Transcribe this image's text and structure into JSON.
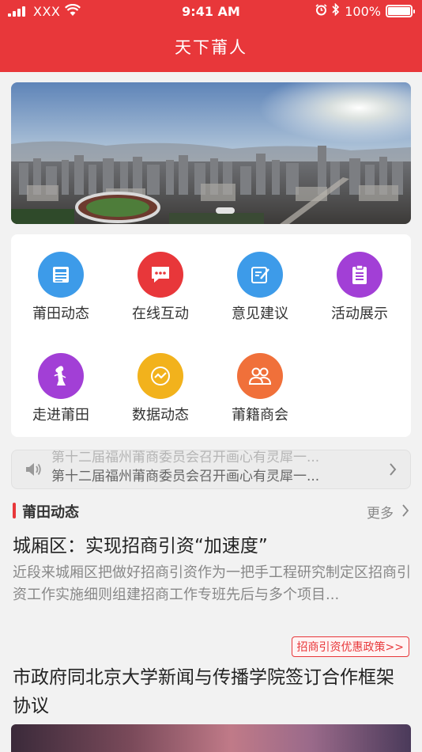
{
  "status_bar": {
    "carrier": "XXX",
    "time": "9:41 AM",
    "battery": "100%"
  },
  "nav": {
    "title": "天下莆人"
  },
  "banner": {
    "image": "city-skyline-photo"
  },
  "menu": [
    {
      "label": "莆田动态",
      "icon": "news-icon",
      "color": "#3d9be9"
    },
    {
      "label": "在线互动",
      "icon": "chat-icon",
      "color": "#e8373a"
    },
    {
      "label": "意见建议",
      "icon": "feedback-icon",
      "color": "#3d9be9"
    },
    {
      "label": "活动展示",
      "icon": "clipboard-icon",
      "color": "#a23fd6"
    },
    {
      "label": "走进莆田",
      "icon": "statue-icon",
      "color": "#a23fd6"
    },
    {
      "label": "数据动态",
      "icon": "chart-icon",
      "color": "#f2b21c"
    },
    {
      "label": "莆籍商会",
      "icon": "group-icon",
      "color": "#f0703a"
    }
  ],
  "ticker": {
    "text": "第十二届福州莆商委员会召开画心有灵犀一..."
  },
  "section": {
    "title": "莆田动态",
    "more": "更多"
  },
  "articles": [
    {
      "title": "城厢区：实现招商引资“加速度”",
      "summary": "近段来城厢区把做好招商引资作为一把手工程研究制定区招商引资工作实施细则组建招商工作专班先后与多个项目...",
      "tag": "招商引资优惠政策>>"
    },
    {
      "title": "市政府同北京大学新闻与传播学院签订合作框架协议"
    }
  ],
  "colors": {
    "accent": "#e8373a"
  }
}
